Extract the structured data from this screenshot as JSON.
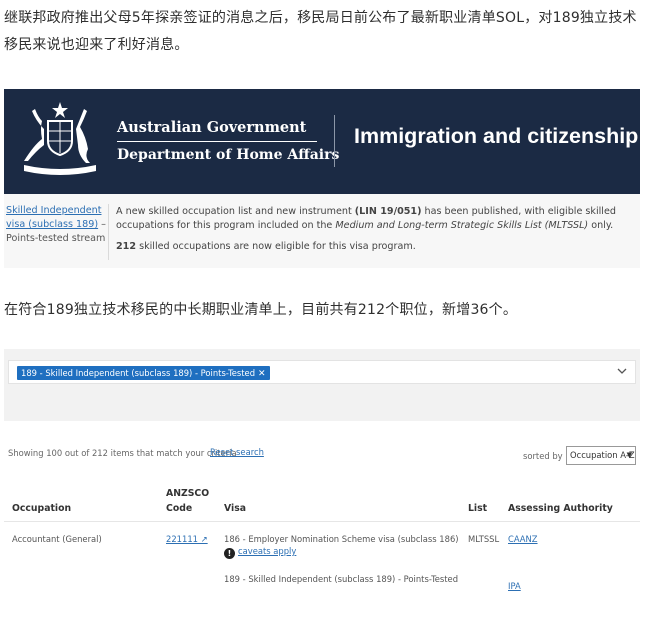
{
  "article": {
    "para1": "继联邦政府推出父母5年探亲签证的消息之后，移民局日前公布了最新职业清单SOL，对189独立技术移民来说也迎来了利好消息。",
    "para2": "在符合189独立技术移民的中长期职业清单上，目前共有212个职位，新增36个。"
  },
  "banner": {
    "gov_line1": "Australian Government",
    "gov_line2": "Department of Home Affairs",
    "site_title": "Immigration and citizenship",
    "bg_color": "#1b2a44"
  },
  "visa_info": {
    "visa_link_line1": "Skilled Independent",
    "visa_link_line2": "visa (subclass 189)",
    "visa_dash": " –",
    "stream": "Points-tested stream",
    "notice_prefix": "A new skilled occupation list and new instrument ",
    "notice_instrument": "(LIN 19/051)",
    "notice_mid": " has been published, with eligible skilled occupations for this program included on the ",
    "notice_list": "Medium and Long-term Strategic Skills List (MLTSSL)",
    "notice_suffix": " only.",
    "eligible_count": "212",
    "eligible_text": " skilled occupations are now eligible for this visa program."
  },
  "filter": {
    "chip_label": "189 - Skilled Independent (subclass 189) - Points-Tested",
    "chip_remove": "✕",
    "accent_color": "#1f6fc0"
  },
  "results": {
    "showing": "Showing 100 out of 212 items that match your criteria",
    "reset": "Reset search",
    "sorted_by": "sorted by",
    "sort_value": "Occupation A-Z"
  },
  "table": {
    "headers": {
      "occupation": "Occupation",
      "anzsco_line1": "ANZSCO",
      "anzsco_line2": "Code",
      "visa": "Visa",
      "list": "List",
      "authority": "Assessing Authority"
    },
    "rows": [
      {
        "occupation": "Accountant (General)",
        "code": "221111 ↗",
        "visa1": "186 - Employer Nomination Scheme visa (subclass 186)",
        "caveat": "caveats apply",
        "visa2": "189 - Skilled Independent (subclass 189) - Points-Tested",
        "list": "MLTSSL",
        "authority1": "CAANZ",
        "authority2": "IPA"
      }
    ]
  }
}
